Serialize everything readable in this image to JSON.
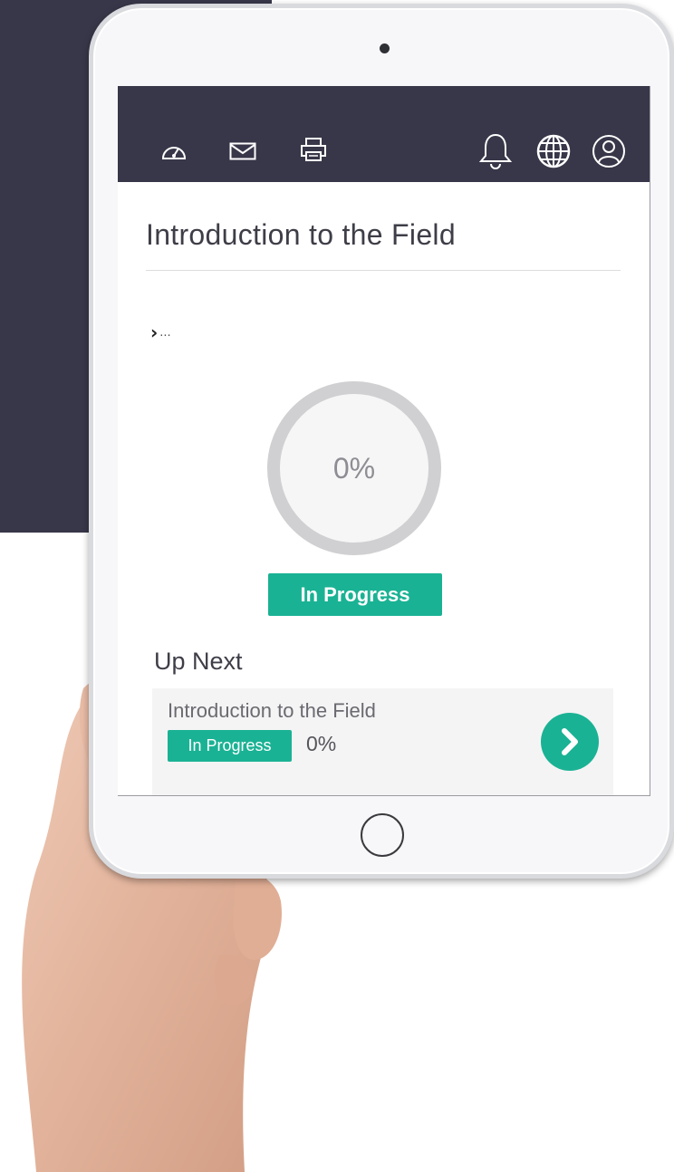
{
  "page": {
    "title": "Introduction to the Field",
    "breadcrumb": "..."
  },
  "toolbar": {
    "left_icons": [
      "dashboard-gauge-icon",
      "envelope-icon",
      "printer-icon"
    ],
    "right_icons": [
      "bell-icon",
      "globe-icon",
      "user-circle-icon"
    ]
  },
  "progress": {
    "percent_label": "0%",
    "value": 0,
    "status": "In Progress"
  },
  "up_next": {
    "heading": "Up Next",
    "item": {
      "name": "Introduction to the Field",
      "status": "In Progress",
      "percent": "0%"
    }
  },
  "colors": {
    "topbar": "#383749",
    "accent": "#1ab294",
    "ring": "#d0d0d2"
  }
}
